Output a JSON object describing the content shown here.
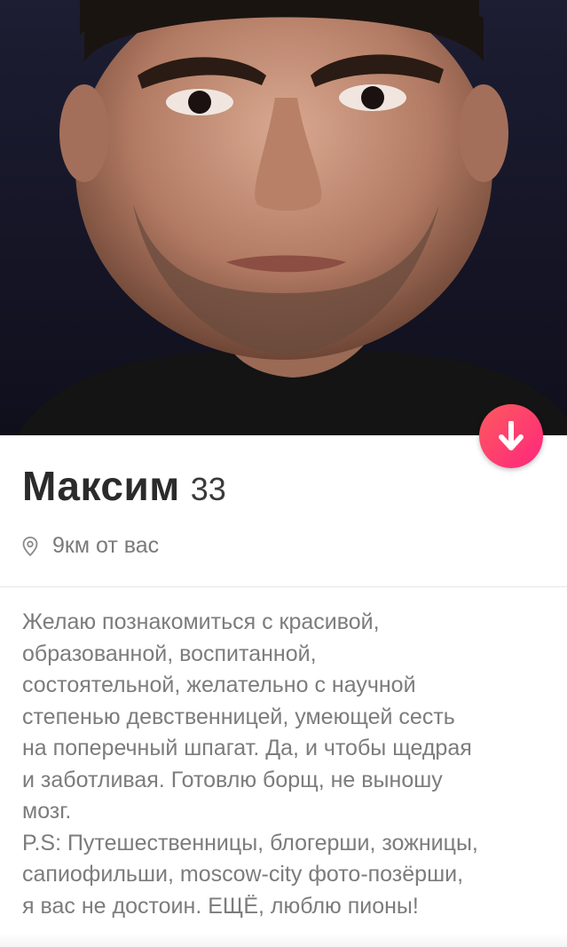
{
  "profile": {
    "name": "Максим",
    "age": "33",
    "distance": "9км от вас",
    "bio_lines": [
      "Желаю познакомиться с красивой,",
      "образованной, воспитанной,",
      "состоятельной, желательно с научной",
      "степенью девственницей, умеющей сесть",
      "на поперечный шпагат. Да, и чтобы щедрая",
      "и заботливая. Готовлю борщ, не выношу",
      "мозг.",
      "P.S: Путешественницы, блогерши, зожницы,",
      "сапиофильши, moscow-city фото-позёрши,",
      "я вас не достоин. ЕЩЁ, люблю пионы!"
    ]
  },
  "icons": {
    "collapse": "arrow-down-icon",
    "location": "location-pin-icon"
  },
  "colors": {
    "accent_start": "#ff5a5f",
    "accent_end": "#fd267d",
    "name_text": "#2b2b2b",
    "secondary_text": "#7a7a7a"
  }
}
